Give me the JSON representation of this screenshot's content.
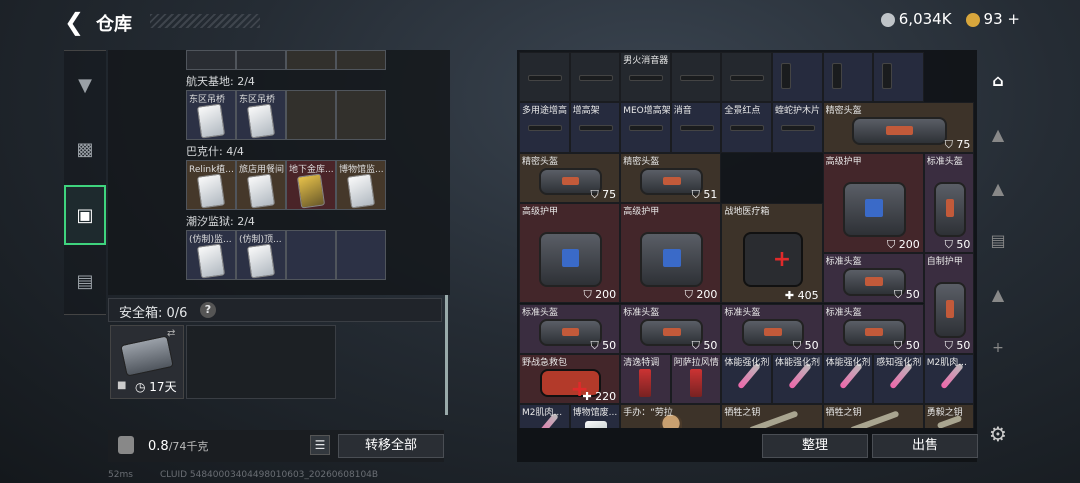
{
  "header": {
    "back_icon": "back-arrow-icon",
    "title": "仓库",
    "currency_1": "6,034K",
    "currency_2": "93",
    "currency_2_plus": "+",
    "coin_1_color": "#bfc4c8",
    "coin_2_color": "#d8a63c"
  },
  "left_rail": {
    "items": [
      "gun-icon",
      "armor-icon",
      "backpack-icon",
      "briefcase-icon"
    ],
    "active_index": 2,
    "accent": "#3fd47e"
  },
  "left_panel": {
    "sections": [
      {
        "label": "航天基地: 2/4",
        "slots": [
          {
            "name": "东区吊桥",
            "color": "blue"
          },
          {
            "name": "东区吊桥",
            "color": "blue"
          },
          {
            "name": "",
            "color": "empty"
          },
          {
            "name": "",
            "color": "empty"
          }
        ]
      },
      {
        "label": "巴克什: 4/4",
        "slots": [
          {
            "name": "Relink植...",
            "color": "brown"
          },
          {
            "name": "旅店用餐间",
            "color": "brown"
          },
          {
            "name": "地下金库...",
            "color": "red"
          },
          {
            "name": "博物馆监...",
            "color": "brown"
          }
        ]
      },
      {
        "label": "潮汐监狱: 2/4",
        "slots": [
          {
            "name": "(仿制)监...",
            "color": "blue"
          },
          {
            "name": "(仿制)顶...",
            "color": "blue"
          },
          {
            "name": "",
            "color": "empty"
          },
          {
            "name": "",
            "color": "empty"
          }
        ]
      }
    ]
  },
  "safe_box": {
    "label": "安全箱: 0/6",
    "help": "?",
    "duration": "17天"
  },
  "bottom_bar": {
    "weight": "0.8",
    "weight_max": "/74千克",
    "transfer_all": "转移全部"
  },
  "actions": {
    "sort": "整理",
    "sell": "出售"
  },
  "footer": {
    "ping": "52ms",
    "uid": "CLUID 54840003404498010603_20260608104B"
  },
  "grid_items": [
    {
      "name": "",
      "bg": "dark"
    },
    {
      "name": "",
      "bg": "dark"
    },
    {
      "name": "男火消音器",
      "bg": "dark"
    },
    {
      "name": "",
      "bg": "dark"
    },
    {
      "name": "",
      "bg": "dark"
    },
    {
      "name": "",
      "bg": "navy"
    },
    {
      "name": "",
      "bg": "navy"
    },
    {
      "name": "",
      "bg": "navy"
    },
    {
      "name": "多用途增高",
      "bg": "navy"
    },
    {
      "name": "增高架",
      "bg": "navy"
    },
    {
      "name": "MEO增高架",
      "bg": "navy"
    },
    {
      "name": "消音",
      "bg": "navy"
    },
    {
      "name": "全景红点",
      "bg": "navy"
    },
    {
      "name": "蝰蛇护木片",
      "bg": "navy"
    },
    {
      "name": "精密头盔",
      "value": "75",
      "bg": "brown"
    },
    {
      "name": "精密头盔",
      "value": "75",
      "bg": "brown"
    },
    {
      "name": "精密头盔",
      "value": "51",
      "bg": "brown"
    },
    {
      "name": "高级护甲",
      "value": "200",
      "bg": "red"
    },
    {
      "name": "标准头盔",
      "value": "50",
      "bg": "purple"
    },
    {
      "name": "高级护甲",
      "value": "200",
      "bg": "red"
    },
    {
      "name": "高级护甲",
      "value": "200",
      "bg": "red"
    },
    {
      "name": "战地医疗箱",
      "value": "+405",
      "bg": "brown"
    },
    {
      "name": "标准头盔",
      "value": "50",
      "bg": "purple"
    },
    {
      "name": "自制护甲",
      "value": "50",
      "bg": "purple"
    },
    {
      "name": "标准头盔",
      "value": "50",
      "bg": "purple"
    },
    {
      "name": "标准头盔",
      "value": "50",
      "bg": "purple"
    },
    {
      "name": "标准头盔",
      "value": "50",
      "bg": "purple"
    },
    {
      "name": "标准头盔",
      "value": "50",
      "bg": "purple"
    },
    {
      "name": "野战急救包",
      "value": "+220",
      "bg": "red"
    },
    {
      "name": "清逸特调",
      "bg": "purple"
    },
    {
      "name": "阿萨拉风情",
      "bg": "purple"
    },
    {
      "name": "体能强化剂",
      "bg": "navy"
    },
    {
      "name": "体能强化剂",
      "bg": "navy"
    },
    {
      "name": "体能强化剂",
      "bg": "navy"
    },
    {
      "name": "感知强化剂",
      "bg": "navy"
    },
    {
      "name": "M2肌肉...",
      "bg": "navy"
    },
    {
      "name": "M2肌肉...",
      "bg": "navy"
    },
    {
      "name": "博物馆废...",
      "bg": "navy"
    },
    {
      "name": "手办：“劳拉",
      "bg": "brown"
    },
    {
      "name": "牺牲之钥",
      "bg": "brown"
    },
    {
      "name": "牺牲之钥",
      "bg": "brown"
    },
    {
      "name": "勇毅之钥",
      "bg": "brown"
    }
  ]
}
